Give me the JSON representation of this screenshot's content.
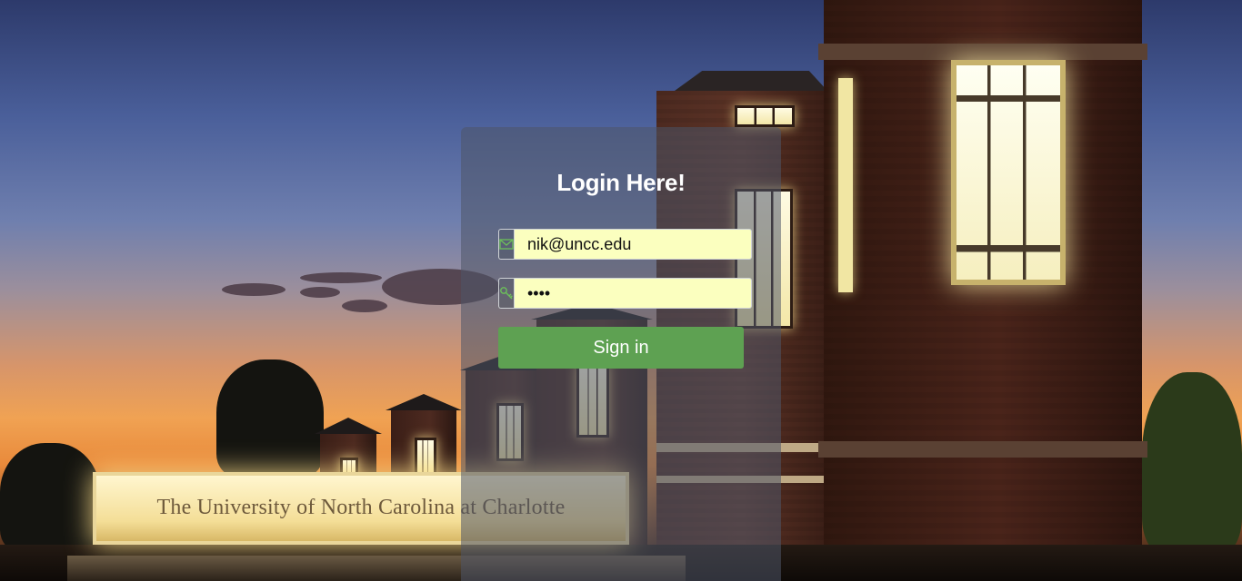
{
  "login": {
    "title": "Login Here!",
    "email_value": "nik@uncc.edu",
    "password_value": "••••",
    "sign_in_label": "Sign in"
  },
  "background": {
    "sign_text": "The University of North Carolina at Charlotte"
  },
  "icons": {
    "email": "envelope-icon",
    "password": "key-icon"
  },
  "colors": {
    "button": "#5ea152",
    "input_fill": "#fbffbf",
    "icon": "#6cbf5a"
  }
}
